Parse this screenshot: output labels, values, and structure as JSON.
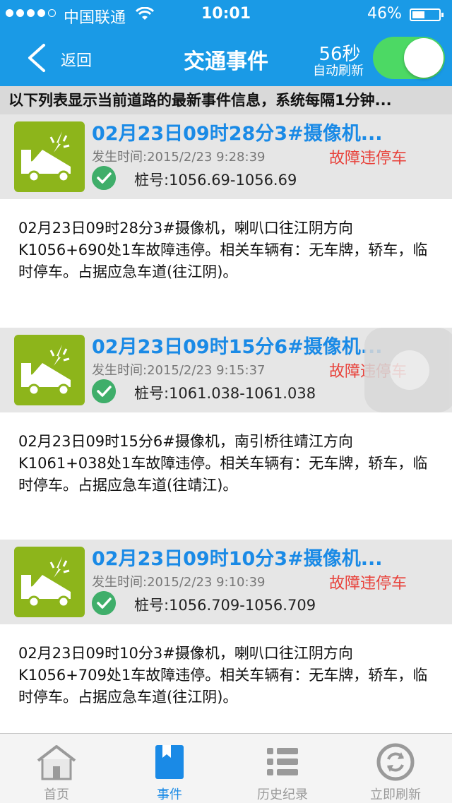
{
  "status_bar": {
    "carrier": "中国联通",
    "time": "10:01",
    "battery": "46%",
    "battery_level": 0.46
  },
  "nav": {
    "back_label": "返回",
    "title": "交通事件",
    "countdown": "56秒",
    "auto_refresh_label": "自动刷新",
    "auto_refresh_on": true,
    "bar_color": "#1a9ae6",
    "toggle_color": "#4cd964"
  },
  "notice": "以下列表显示当前道路的最新事件信息，系统每隔1分钟...",
  "events": [
    {
      "title": "02月23日09时28分3#摄像机...",
      "time": "发生时间:2015/2/23 9:28:39",
      "type": "故障违停车",
      "stake": "桩号:1056.69-1056.69",
      "desc": "02月23日09时28分3#摄像机，喇叭口往江阴方向K1056+690处1车故障违停。相关车辆有：无车牌，轿车，临时停车。占据应急车道(往江阴)。"
    },
    {
      "title": "02月23日09时15分6#摄像机...",
      "time": "发生时间:2015/2/23 9:15:37",
      "type": "故障违停车",
      "stake": "桩号:1061.038-1061.038",
      "desc": "02月23日09时15分6#摄像机，南引桥往靖江方向K1061+038处1车故障违停。相关车辆有：无车牌，轿车，临时停车。占据应急车道(往靖江)。"
    },
    {
      "title": "02月23日09时10分3#摄像机...",
      "time": "发生时间:2015/2/23 9:10:39",
      "type": "故障违停车",
      "stake": "桩号:1056.709-1056.709",
      "desc": "02月23日09时10分3#摄像机，喇叭口往江阴方向K1056+709处1车故障违停。相关车辆有：无车牌，轿车，临时停车。占据应急车道(往江阴)。"
    }
  ],
  "tabs": [
    {
      "label": "首页",
      "icon": "home-icon",
      "active": false
    },
    {
      "label": "事件",
      "icon": "bookmark-icon",
      "active": true
    },
    {
      "label": "历史纪录",
      "icon": "list-icon",
      "active": false
    },
    {
      "label": "立即刷新",
      "icon": "refresh-icon",
      "active": false
    }
  ],
  "colors": {
    "title_blue": "#1a8ae6",
    "event_type_red": "#e8413a",
    "icon_green": "#8db51b",
    "check_green": "#3fae6a"
  }
}
